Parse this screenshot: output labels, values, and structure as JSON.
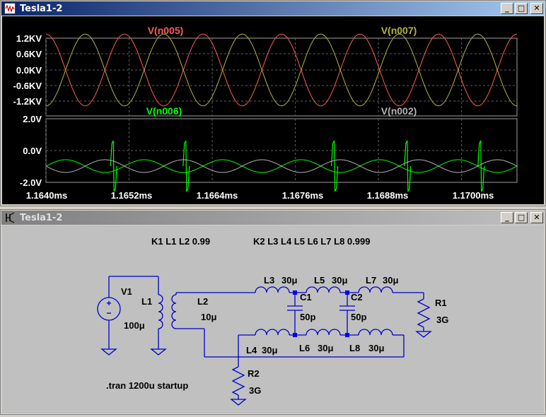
{
  "waveform_window": {
    "title": "Tesla1-2",
    "buttons": {
      "minimize": "_",
      "restore": "□",
      "close": "✕"
    },
    "top_pane": {
      "traces": [
        {
          "label": "V(n005)",
          "color": "#ff5a5a"
        },
        {
          "label": "V(n007)",
          "color": "#b4b43c"
        }
      ],
      "y_ticks": [
        "1.2KV",
        "0.6KV",
        "0.0KV",
        "-0.6KV",
        "-1.2KV"
      ]
    },
    "bottom_pane": {
      "traces": [
        {
          "label": "V(n006)",
          "color": "#00ff00"
        },
        {
          "label": "V(n002)",
          "color": "#b4b4b4"
        }
      ],
      "y_ticks": [
        "2.0V",
        "0.0V",
        "-2.0V"
      ]
    },
    "x_ticks": [
      "1.1640ms",
      "1.1652ms",
      "1.1664ms",
      "1.1676ms",
      "1.1688ms",
      "1.1700ms"
    ]
  },
  "chart_data": [
    {
      "type": "line",
      "x_range_ms": [
        1.164,
        1.1708
      ],
      "ylim": [
        -1.2,
        1.2
      ],
      "y_unit": "KV",
      "series": [
        {
          "name": "V(n005)",
          "amplitude": 1.2,
          "cycles_in_view": 6,
          "phase_deg": 0
        },
        {
          "name": "V(n007)",
          "amplitude": 1.2,
          "cycles_in_view": 6,
          "phase_deg": 180
        }
      ]
    },
    {
      "type": "line",
      "x_range_ms": [
        1.164,
        1.1708
      ],
      "ylim": [
        -2.0,
        2.0
      ],
      "y_unit": "V",
      "series": [
        {
          "name": "V(n006)",
          "amplitude": 0.4,
          "spike_amplitude": 1.6,
          "cycles_in_view": 6
        },
        {
          "name": "V(n002)",
          "amplitude": 0.4,
          "cycles_in_view": 6
        }
      ]
    }
  ],
  "schematic_window": {
    "title": "Tesla1-2",
    "buttons": {
      "minimize": "_",
      "restore": "□",
      "close": "✕"
    },
    "directives": {
      "k1": "K1 L1 L2 0.99",
      "k2": "K2 L3 L4 L5 L6 L7 L8 0.999",
      "tran": ".tran 1200u startup"
    },
    "components": {
      "V1": {
        "name": "V1",
        "value": "100μ"
      },
      "L1": {
        "name": "L1"
      },
      "L2": {
        "name": "L2",
        "value": "10μ"
      },
      "L3": {
        "name": "L3",
        "value": "30μ"
      },
      "L4": {
        "name": "L4",
        "value": "30μ"
      },
      "L5": {
        "name": "L5",
        "value": "30μ"
      },
      "L6": {
        "name": "L6",
        "value": "30μ"
      },
      "L7": {
        "name": "L7",
        "value": "30μ"
      },
      "L8": {
        "name": "L8",
        "value": "30μ"
      },
      "C1": {
        "name": "C1",
        "value": "50p"
      },
      "C2": {
        "name": "C2",
        "value": "50p"
      },
      "R1": {
        "name": "R1",
        "value": "3G"
      },
      "R2": {
        "name": "R2",
        "value": "3G"
      }
    },
    "wire_color": "#0000c8",
    "text_color": "#000000"
  }
}
